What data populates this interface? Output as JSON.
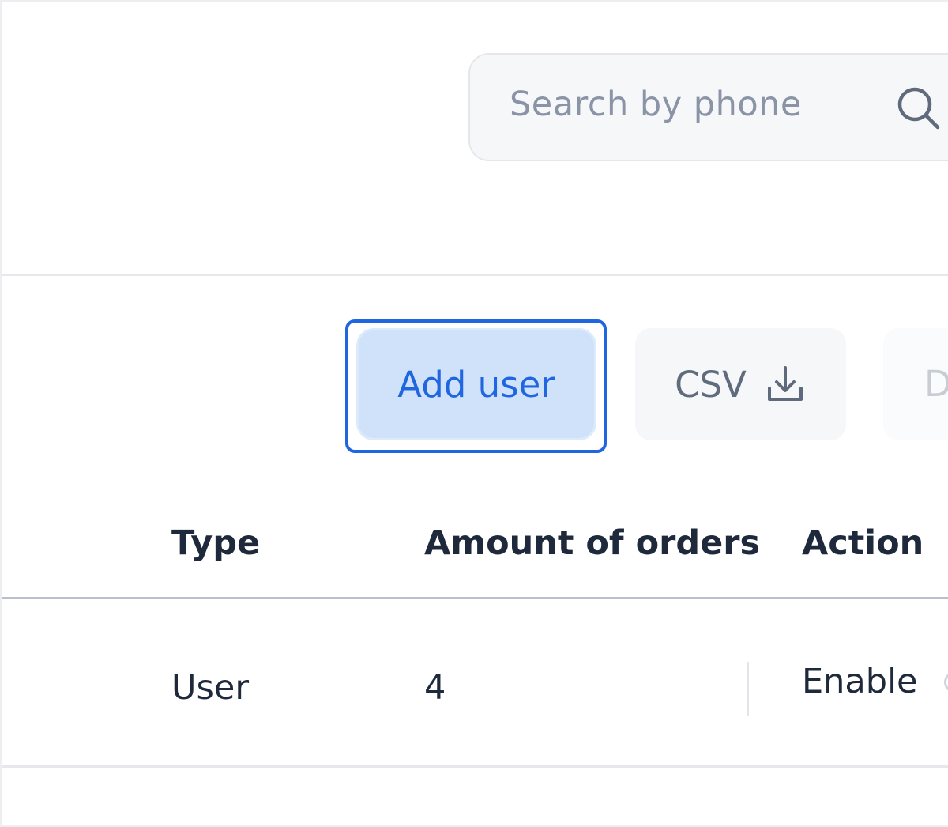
{
  "search": {
    "placeholder": "Search by phone",
    "icon": "search-icon"
  },
  "toolbar": {
    "add_user_label": "Add user",
    "csv_label": "CSV",
    "csv_icon": "download-icon",
    "third_label": "D"
  },
  "table": {
    "columns": [
      "Type",
      "Amount of orders",
      "Action"
    ],
    "rows": [
      {
        "type": "User",
        "amount_of_orders": "4",
        "action": "Enable"
      }
    ]
  },
  "colors": {
    "accent": "#1f66e0",
    "accent_bg": "#cfe2fa",
    "text": "#1e293b",
    "muted": "#8a94a6"
  }
}
